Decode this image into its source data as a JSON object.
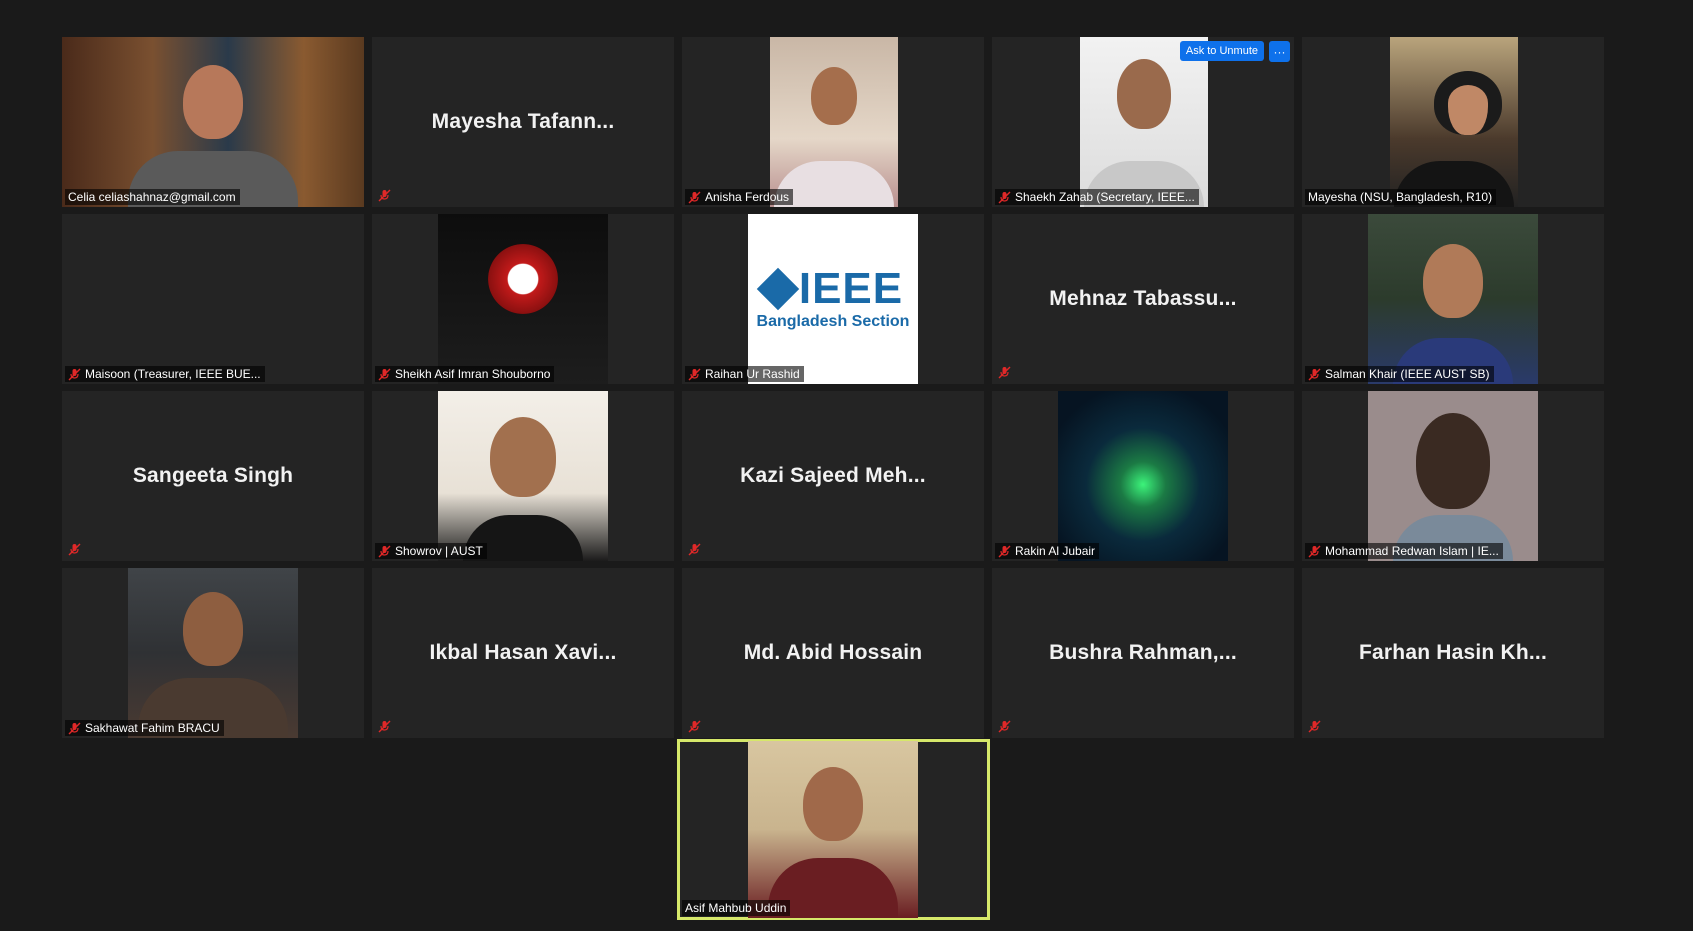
{
  "meeting": {
    "ask_to_unmute": "Ask to Unmute",
    "more_label": "···"
  },
  "participants": [
    {
      "name": "Celia celiashahnaz@gmail.com",
      "video": true,
      "muted": false
    },
    {
      "name": "Mayesha Tafann...",
      "video": false,
      "muted": true
    },
    {
      "name": "Anisha Ferdous",
      "video": true,
      "muted": true
    },
    {
      "name": "Shaekh Zahab (Secretary, IEEE...",
      "video": true,
      "muted": true
    },
    {
      "name": "Mayesha (NSU, Bangladesh, R10)",
      "video": true,
      "muted": false
    },
    {
      "name": "Maisoon (Treasurer, IEEE BUE...",
      "video": false,
      "muted": true
    },
    {
      "name": "Sheikh Asif Imran Shouborno",
      "video": true,
      "muted": true
    },
    {
      "name": "Raihan Ur Rashid",
      "video": true,
      "muted": true,
      "logo_text": "IEEE",
      "logo_sub": "Bangladesh Section"
    },
    {
      "name": "Mehnaz Tabassu...",
      "video": false,
      "muted": true
    },
    {
      "name": "Salman Khair (IEEE AUST SB)",
      "video": true,
      "muted": true
    },
    {
      "name": "Sangeeta Singh",
      "video": false,
      "muted": true
    },
    {
      "name": "Showrov | AUST",
      "video": true,
      "muted": true
    },
    {
      "name": "Kazi Sajeed Meh...",
      "video": false,
      "muted": true
    },
    {
      "name": "Rakin Al Jubair",
      "video": true,
      "muted": true
    },
    {
      "name": "Mohammad Redwan Islam | IE...",
      "video": true,
      "muted": true
    },
    {
      "name": "Sakhawat Fahim BRACU",
      "video": true,
      "muted": true
    },
    {
      "name": "Ikbal Hasan Xavi...",
      "video": false,
      "muted": true
    },
    {
      "name": "Md. Abid Hossain",
      "video": false,
      "muted": true
    },
    {
      "name": "Bushra Rahman,...",
      "video": false,
      "muted": true
    },
    {
      "name": "Farhan Hasin Kh...",
      "video": false,
      "muted": true
    },
    {
      "name": "Asif Mahbub Uddin",
      "video": true,
      "muted": false,
      "active_speaker": true
    }
  ],
  "colors": {
    "background": "#1a1a1a",
    "tile": "#242424",
    "active_border": "#d6e86a",
    "button_blue": "#0e71eb",
    "mute_red": "#e02828"
  }
}
